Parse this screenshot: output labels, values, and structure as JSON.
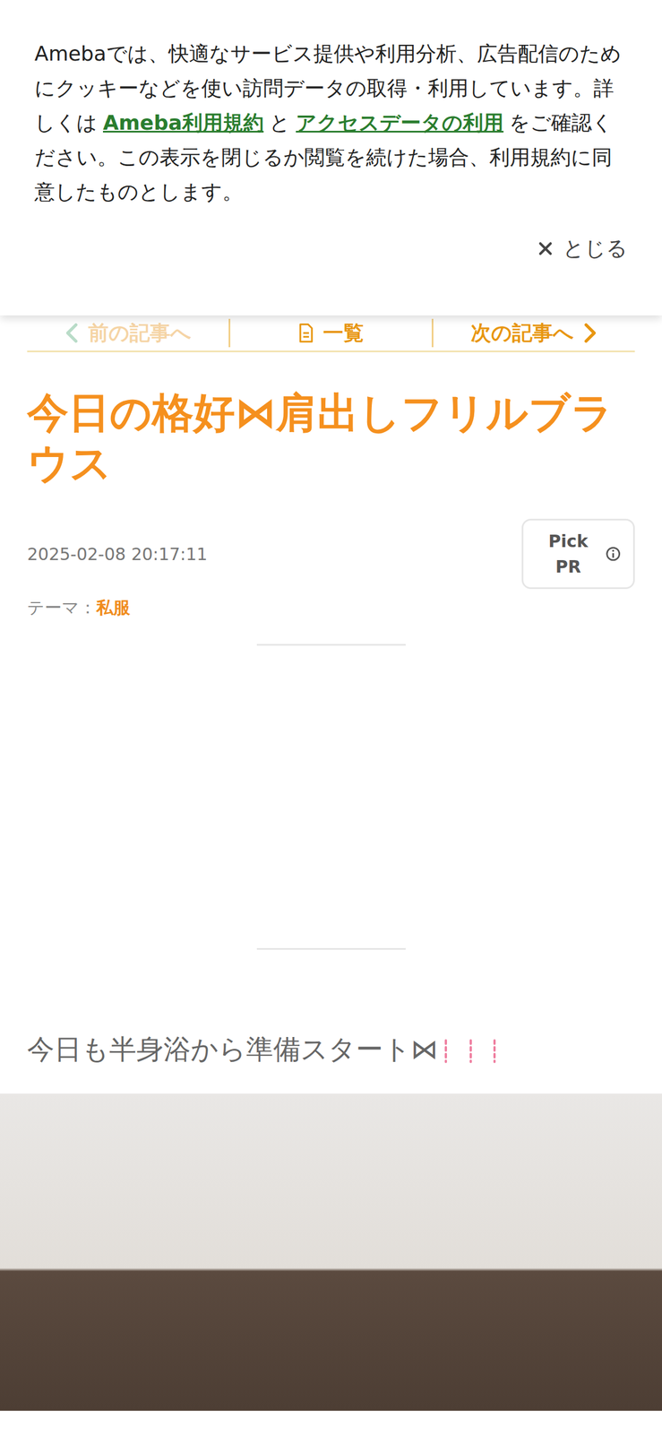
{
  "cookie_banner": {
    "text_before": "Amebaでは、快適なサービス提供や利用分析、広告配信のためにクッキーなどを使い訪問データの取得・利用しています。詳しくは",
    "link_terms": "Ameba利用規約",
    "conjunction": "と",
    "link_access": "アクセスデータの利用",
    "text_after": "をご確認ください。この表示を閉じるか閲覧を続けた場合、利用規約に同意したものとします。",
    "close": "とじる"
  },
  "article_nav": {
    "prev": {
      "label": "前の記事へ",
      "disabled": true
    },
    "list": "一覧",
    "next": "次の記事へ"
  },
  "article": {
    "title": "今日の格好⋈肩出しフリルブラウス",
    "date": "2025-02-08 20:17:11",
    "pick_pr": "Pick PR",
    "theme_label": "テーマ：",
    "theme": "私服",
    "body_text": "今日も半身浴から準備スタート⋈"
  }
}
